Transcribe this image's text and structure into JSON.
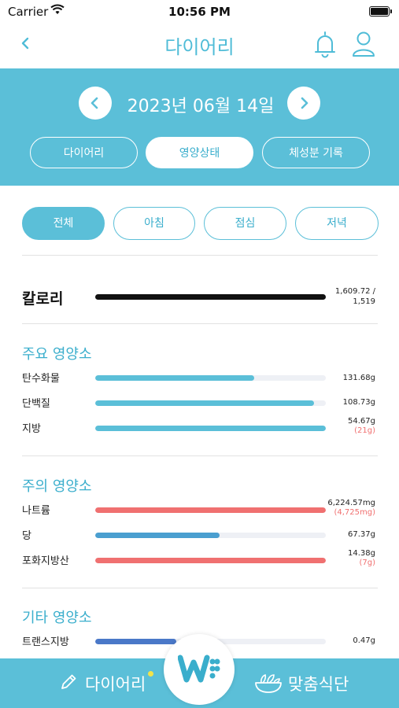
{
  "status_bar": {
    "carrier": "Carrier",
    "time": "10:56 PM"
  },
  "nav": {
    "title": "다이어리"
  },
  "date": {
    "text": "2023년 06월 14일"
  },
  "main_tabs": [
    {
      "label": "다이어리",
      "active": false
    },
    {
      "label": "영양상태",
      "active": true
    },
    {
      "label": "체성분 기록",
      "active": false
    }
  ],
  "meal_tabs": [
    {
      "label": "전체",
      "active": true
    },
    {
      "label": "아침",
      "active": false
    },
    {
      "label": "점심",
      "active": false
    },
    {
      "label": "저녁",
      "active": false
    }
  ],
  "calories": {
    "label": "칼로리",
    "value": "1,609.72 /",
    "target": "1,519",
    "progress": 1.0
  },
  "sections": [
    {
      "title": "주요 영양소",
      "items": [
        {
          "label": "탄수화물",
          "value": "131.68g",
          "recommended": "",
          "progress": 0.69,
          "color": "#5bbfd8"
        },
        {
          "label": "단백질",
          "value": "108.73g",
          "recommended": "",
          "progress": 0.95,
          "color": "#5bbfd8"
        },
        {
          "label": "지방",
          "value": "54.67g",
          "recommended": "(21g)",
          "progress": 1.0,
          "color": "#5bbfd8"
        }
      ]
    },
    {
      "title": "주의 영양소",
      "items": [
        {
          "label": "나트륨",
          "value": "6,224.57mg",
          "recommended": "(4,725mg)",
          "progress": 1.0,
          "color": "#f07070"
        },
        {
          "label": "당",
          "value": "67.37g",
          "recommended": "",
          "progress": 0.54,
          "color": "#4a9fd0"
        },
        {
          "label": "포화지방산",
          "value": "14.38g",
          "recommended": "(7g)",
          "progress": 1.0,
          "color": "#f07070"
        }
      ]
    },
    {
      "title": "기타 영양소",
      "items": [
        {
          "label": "트랜스지방",
          "value": "0.47g",
          "recommended": "",
          "progress": 0.35,
          "color": "#4a78c8"
        }
      ]
    }
  ],
  "tab_bar": {
    "diary_label": "다이어리",
    "diet_label": "맞춤식단"
  },
  "icons": {
    "back": "chevron-left-icon",
    "bell": "bell-icon",
    "user": "user-icon",
    "prev": "chevron-left-icon",
    "next": "chevron-right-icon",
    "pencil": "pencil-icon",
    "bowl": "salad-bowl-icon",
    "logo": "w-logo-icon"
  },
  "colors": {
    "accent": "#5bbfd8",
    "title": "#4fbcd7",
    "warning": "#f07070",
    "dot": "#f2e34a"
  }
}
